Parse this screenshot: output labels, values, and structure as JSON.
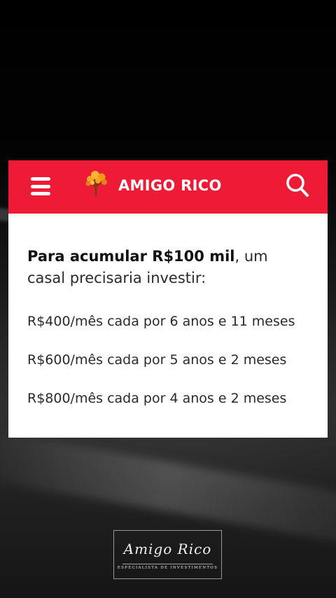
{
  "header": {
    "brand": "AMIGO RICO",
    "menu_icon": "hamburger-menu-icon",
    "logo_icon": "tree-icon",
    "search_icon": "search-icon",
    "background_color": "#ee1b36"
  },
  "content": {
    "intro_bold": "Para acumular R$100 mil",
    "intro_rest": ", um casal precisaria investir:",
    "options": [
      "R$400/mês cada por 6 anos e 11 meses",
      "R$600/mês cada por 5 anos e 2 meses",
      "R$800/mês cada por 4 anos e 2 meses"
    ]
  },
  "signature": {
    "script": "Amigo Rico",
    "subtitle": "ESPECIALISTA DE INVESTIMENTOS"
  }
}
